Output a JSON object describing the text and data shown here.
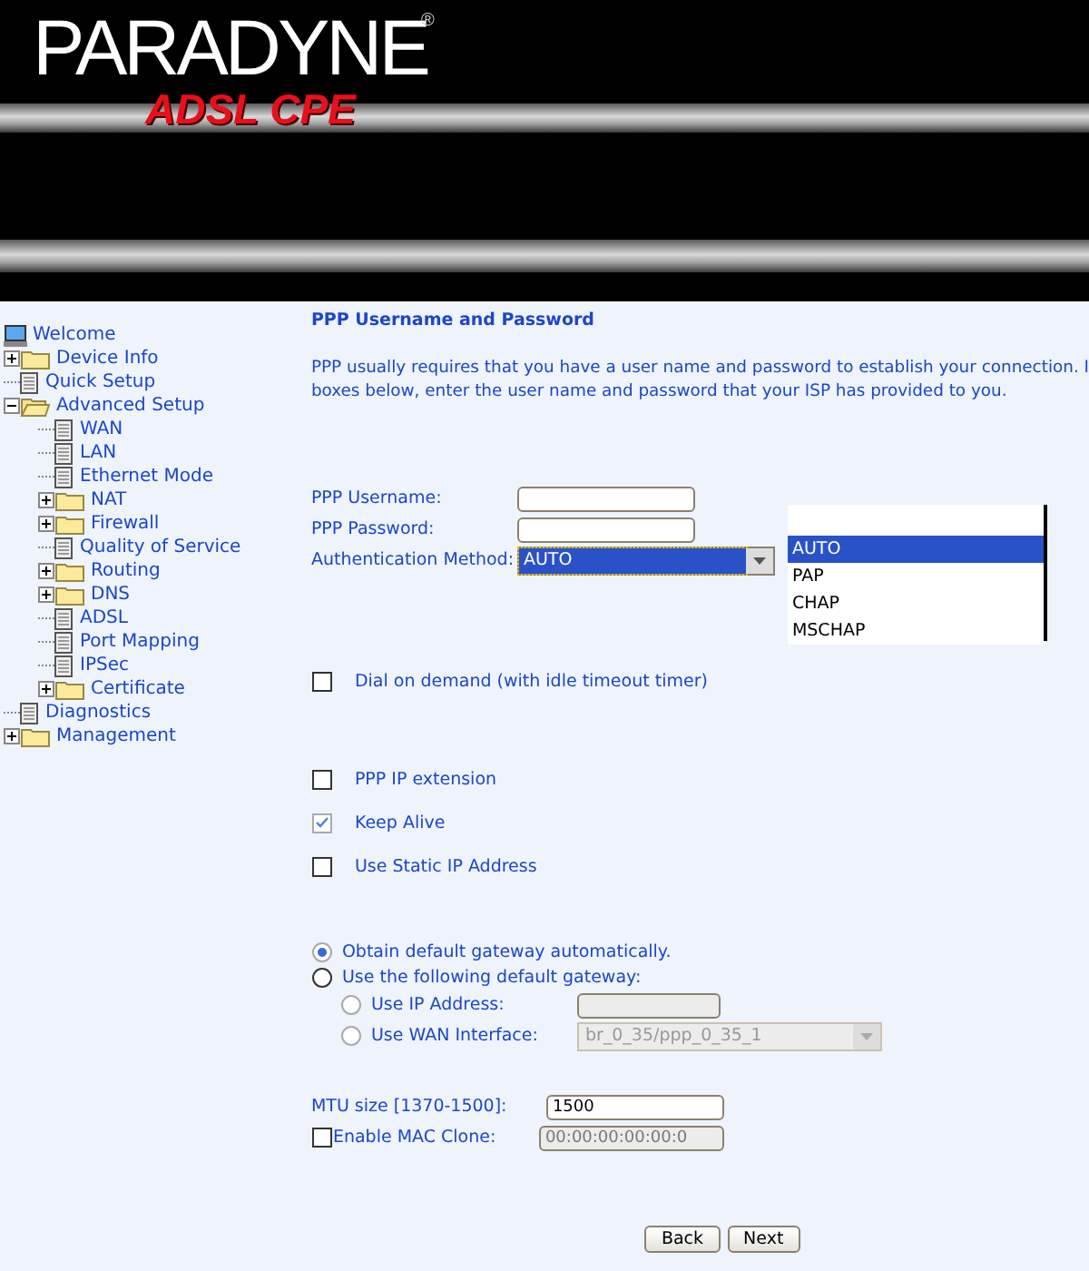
{
  "header": {
    "brand": "PARADYNE",
    "registered": "®",
    "product": "ADSL CPE"
  },
  "sidebar": {
    "items": [
      {
        "label": "Welcome",
        "kind": "computer"
      },
      {
        "label": "Device Info",
        "kind": "folder",
        "expanded": false
      },
      {
        "label": "Quick Setup",
        "kind": "page"
      },
      {
        "label": "Advanced Setup",
        "kind": "folder",
        "expanded": true,
        "children": [
          {
            "label": "WAN",
            "kind": "page"
          },
          {
            "label": "LAN",
            "kind": "page"
          },
          {
            "label": "Ethernet Mode",
            "kind": "page"
          },
          {
            "label": "NAT",
            "kind": "folder",
            "expanded": false
          },
          {
            "label": "Firewall",
            "kind": "folder",
            "expanded": false
          },
          {
            "label": "Quality of Service",
            "kind": "page"
          },
          {
            "label": "Routing",
            "kind": "folder",
            "expanded": false
          },
          {
            "label": "DNS",
            "kind": "folder",
            "expanded": false
          },
          {
            "label": "ADSL",
            "kind": "page"
          },
          {
            "label": "Port Mapping",
            "kind": "page"
          },
          {
            "label": "IPSec",
            "kind": "page"
          },
          {
            "label": "Certificate",
            "kind": "folder",
            "expanded": false
          }
        ]
      },
      {
        "label": "Diagnostics",
        "kind": "page"
      },
      {
        "label": "Management",
        "kind": "folder",
        "expanded": false
      }
    ]
  },
  "page": {
    "title": "PPP Username and Password",
    "intro": [
      "PPP usually requires that you have a user name and password to establish your connection. I",
      "boxes below, enter the user name and password that your ISP has provided to you."
    ],
    "username": {
      "label": "PPP Username:"
    },
    "password": {
      "label": "PPP Password:"
    },
    "auth": {
      "label": "Authentication Method:",
      "value": "AUTO",
      "options": [
        {
          "label": "AUTO",
          "selected": true
        },
        {
          "label": "PAP",
          "selected": false
        },
        {
          "label": "CHAP",
          "selected": false
        },
        {
          "label": "MSCHAP",
          "selected": false
        }
      ]
    },
    "dial_on_demand": {
      "label": "Dial on demand (with idle timeout timer)",
      "checked": false
    },
    "options": [
      {
        "label": "PPP IP extension",
        "checked": false,
        "disabled": false
      },
      {
        "label": "Keep Alive",
        "checked": true,
        "disabled": true
      },
      {
        "label": "Use Static IP Address",
        "checked": false,
        "disabled": false
      }
    ],
    "gateway": [
      {
        "label": "Obtain default gateway automatically.",
        "selected": true,
        "disabled": true
      },
      {
        "label": "Use the following default gateway:",
        "selected": false,
        "disabled": false
      }
    ],
    "gateway_sub": [
      {
        "label": "Use IP Address:",
        "selected": false,
        "kind": "input"
      },
      {
        "label": "Use WAN Interface:",
        "selected": false,
        "kind": "select",
        "value": "br_0_35/ppp_0_35_1"
      }
    ],
    "mtu": {
      "label": "MTU size [1370-1500]:",
      "value": "1500"
    },
    "mac_clone": {
      "label": "Enable MAC Clone:",
      "checked": false,
      "value": "00:00:00:00:00:0"
    },
    "buttons": [
      "Back",
      "Next"
    ]
  }
}
